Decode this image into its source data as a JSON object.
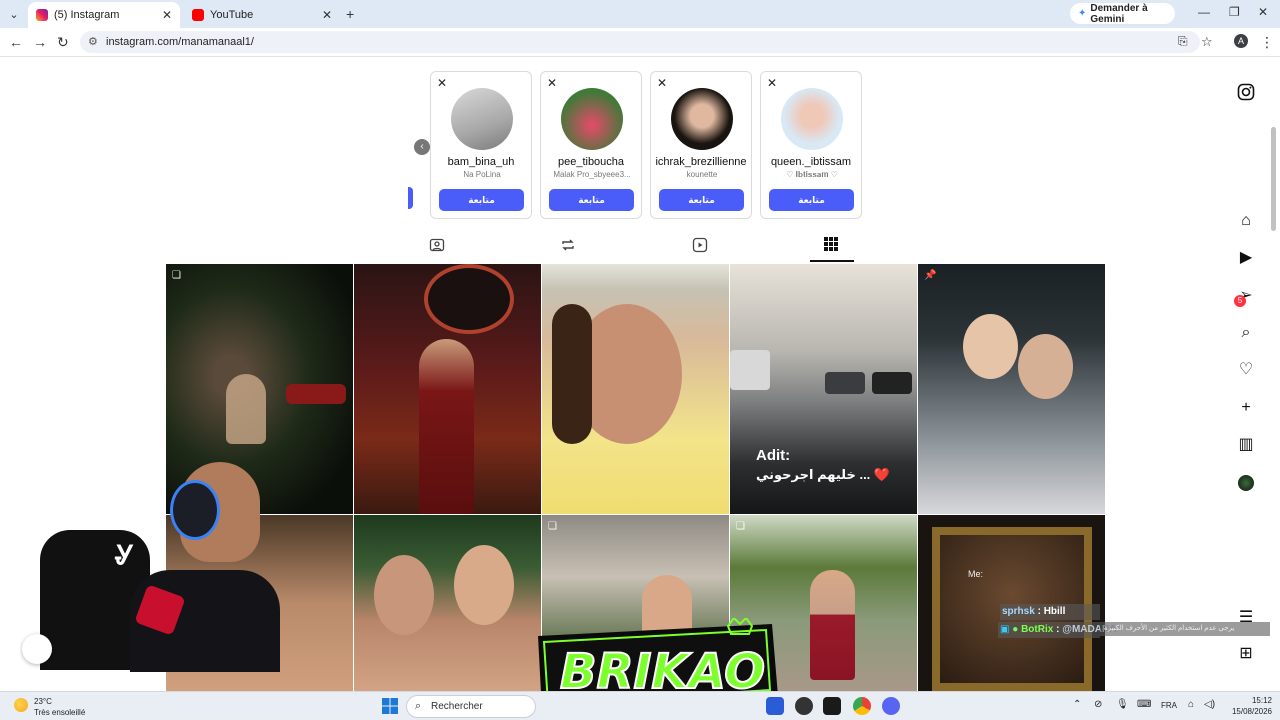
{
  "browser": {
    "tabs": [
      {
        "title": "(5) Instagram",
        "active": true
      },
      {
        "title": "YouTube",
        "active": false
      }
    ],
    "new_tab": "+",
    "gemini_label": "Demander à Gemini",
    "url": "instagram.com/manamanaal1/",
    "profile_initial": "A"
  },
  "suggestions": [
    {
      "username": "bam_bina_uh",
      "subtitle": "Na PoLina",
      "follow": "متابعة"
    },
    {
      "username": "pee_tiboucha",
      "subtitle": "Malak Pro_sbyeee3...",
      "follow": "متابعة"
    },
    {
      "username": "ichrak_brezillienne",
      "subtitle": "kounette",
      "follow": "متابعة"
    },
    {
      "username": "queen._ibtissam",
      "subtitle": "♡ 𝐈𝐛𝐭𝐢𝐬𝐬𝐚𝐦 ♡",
      "follow": "متابعة"
    }
  ],
  "profile_tabs": [
    "posts-grid",
    "reels",
    "reposts",
    "tagged"
  ],
  "posts": [
    {
      "caption_title": "",
      "caption_text": ""
    },
    {
      "caption_title": "",
      "caption_text": ""
    },
    {
      "caption_title": "",
      "caption_text": ""
    },
    {
      "caption_title": "Adit:",
      "caption_text": "خليهم اجرحوني ... ❤️"
    },
    {
      "caption_title": "",
      "caption_text": ""
    },
    {
      "caption_title": "",
      "caption_text": ""
    },
    {
      "caption_title": "",
      "caption_text": ""
    },
    {
      "caption_title": "",
      "caption_text": ""
    },
    {
      "caption_title": "",
      "caption_text": ""
    },
    {
      "caption_title": "Me:",
      "caption_text": ""
    }
  ],
  "sidebar": {
    "notification_count": "5"
  },
  "chat": [
    {
      "user": "sprhsk",
      "message": "Hbill"
    },
    {
      "user": "BotRix",
      "message": "@MADARA"
    }
  ],
  "chat_banner": "يرجى عدم استخدام الكثير من الأحرف الكبيرة",
  "overlay_logo": "BRIKAO",
  "taskbar": {
    "temperature": "23°C",
    "weather": "Très ensoleillé",
    "search": "Rechercher",
    "lang": "FRA",
    "time": "15:12",
    "date": "15/08/2026"
  }
}
